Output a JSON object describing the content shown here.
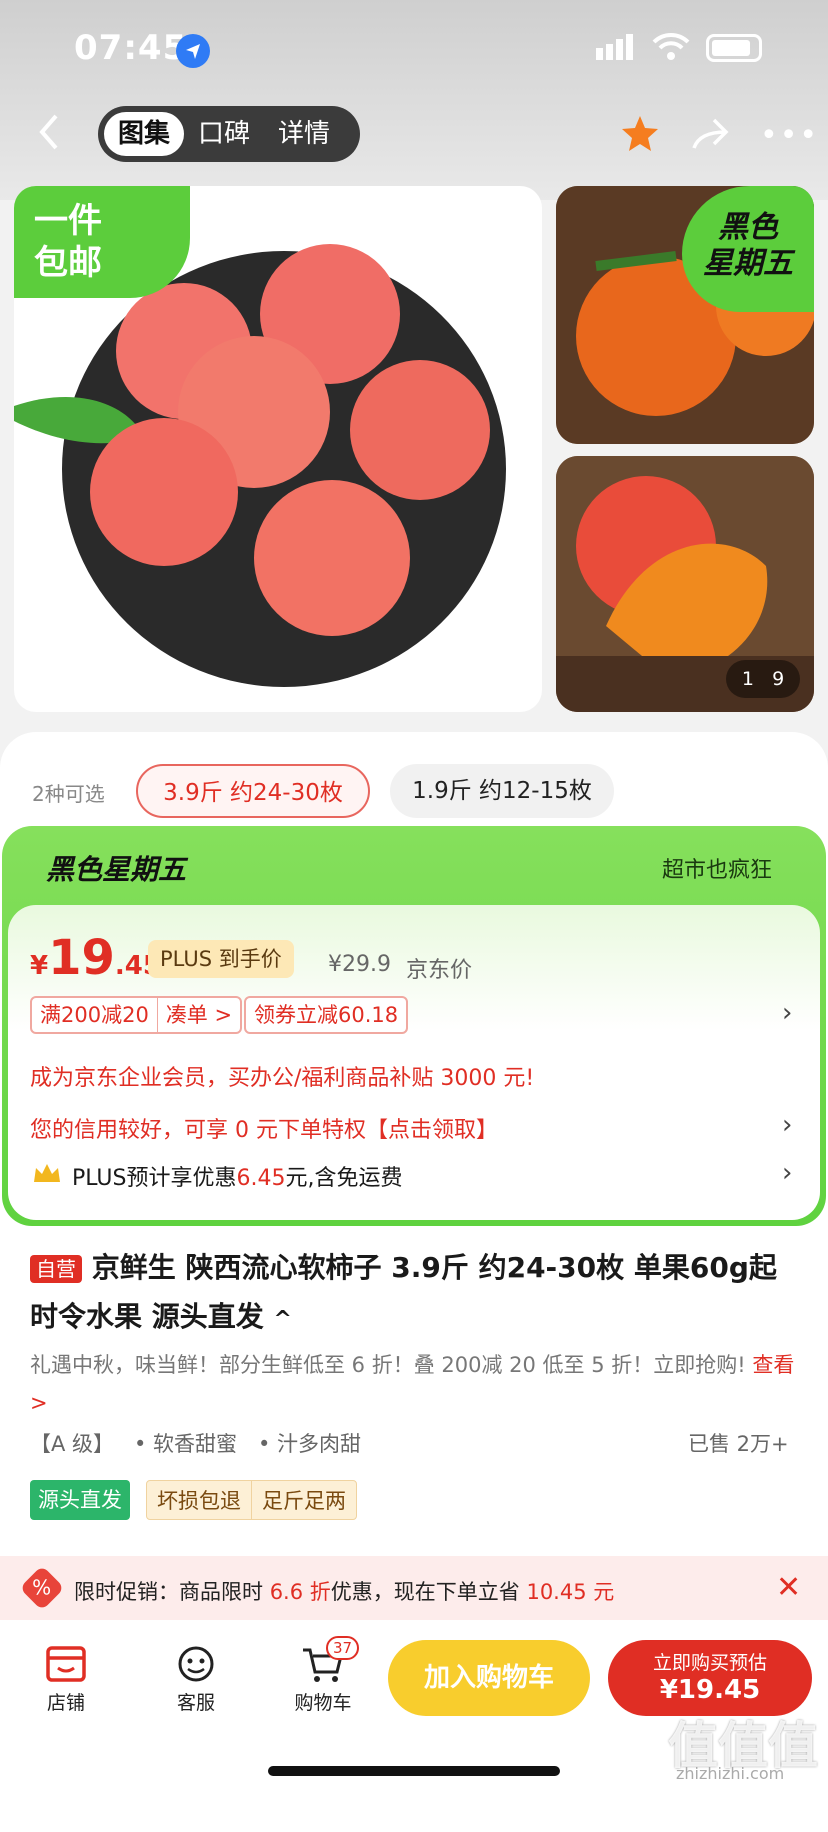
{
  "status": {
    "time": "07:45"
  },
  "nav": {
    "tabs": [
      "图集",
      "口碑",
      "详情"
    ]
  },
  "gallery": {
    "badge_main": [
      "一件",
      "包邮"
    ],
    "badge_side": [
      "黑色",
      "星期五"
    ],
    "counter_cur": "1",
    "counter_total": "9"
  },
  "specs": {
    "label": "2种可选",
    "options": [
      "3.9斤 约24-30枚",
      "1.9斤 约12-15枚"
    ]
  },
  "promo_banner": {
    "logo": "黑色星期五",
    "slogan": "超市也疯狂"
  },
  "price": {
    "symbol": "¥",
    "integer": "19",
    "decimal": ".45",
    "plus_label": "PLUS 到手价",
    "orig_price": "¥29.9",
    "orig_label": "京东价"
  },
  "coupons": {
    "tag1": "满200减20",
    "tag1_link": "凑单 >",
    "tag2": "领券立减60.18"
  },
  "offers": {
    "enterprise": "成为京东企业会员，买办公/福利商品补贴 3000 元!",
    "credit": "您的信用较好，可享 0 元下单特权【点击领取】",
    "plus_pre": "PLUS预计享优惠",
    "plus_amt": "6.45",
    "plus_post": "元,含免运费"
  },
  "product": {
    "self_tag": "自营",
    "title": "京鲜生 陕西流心软柿子 3.9斤 约24-30枚 单果60g起 时令水果 源头直发",
    "subtitle": "礼遇中秋，味当鲜！部分生鲜低至 6 折！叠 200减 20 低至 5 折！立即抢购!",
    "see_more": "查看>",
    "grade": "【A 级】",
    "feat1": "• 软香甜蜜",
    "feat2": "• 汁多肉甜",
    "sold": "已售 2万+",
    "svc_green": "源头直发",
    "svc1": "坏损包退",
    "svc2": "足斤足两"
  },
  "limited": {
    "pre": "限时促销：商品限时 ",
    "discount": "6.6 折",
    "mid": "优惠，现在下单立省 ",
    "save": "10.45 元"
  },
  "bottom": {
    "shop": "店铺",
    "service": "客服",
    "cart": "购物车",
    "cart_count": "37",
    "add_cart": "加入购物车",
    "buy_top": "立即购买预估",
    "buy_price": "¥19.45"
  },
  "watermark": {
    "cn": "值值值",
    "en": "zhizhizhi.com"
  }
}
